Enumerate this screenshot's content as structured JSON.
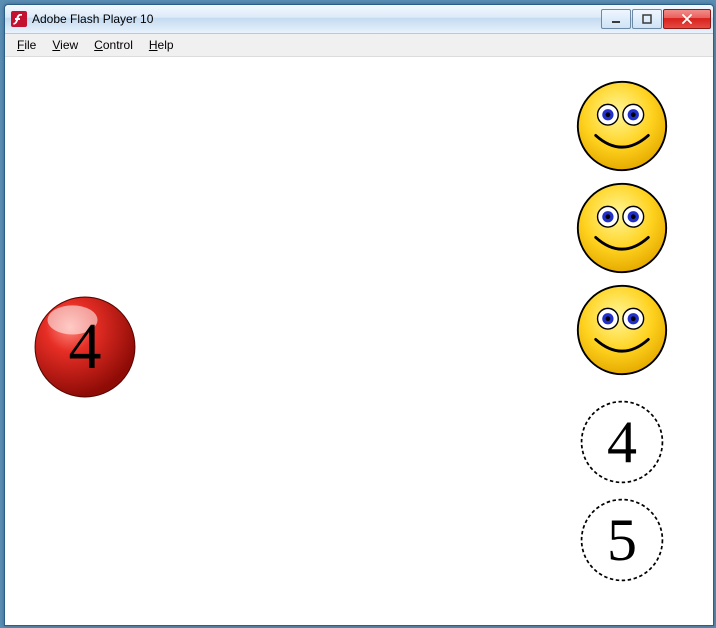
{
  "window": {
    "title": "Adobe Flash Player 10"
  },
  "menu": {
    "file": {
      "label": "File",
      "accel": "F"
    },
    "view": {
      "label": "View",
      "accel": "V"
    },
    "control": {
      "label": "Control",
      "accel": "C"
    },
    "help": {
      "label": "Help",
      "accel": "H"
    }
  },
  "game": {
    "current_number": "4",
    "option_a": "4",
    "option_b": "5"
  }
}
